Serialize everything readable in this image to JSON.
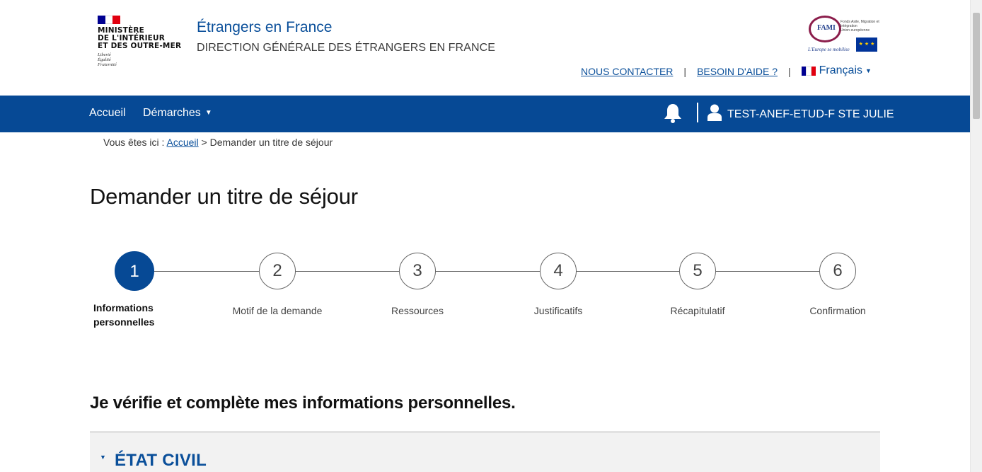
{
  "header": {
    "ministry_lines": [
      "MINISTÈRE",
      "DE L'INTÉRIEUR",
      "ET DES OUTRE-MER"
    ],
    "motto_lines": [
      "Liberté",
      "Égalité",
      "Fraternité"
    ],
    "site_title": "Étrangers en France",
    "site_subtitle": "DIRECTION GÉNÉRALE DES ÉTRANGERS EN FRANCE",
    "fami_text": "FAMI",
    "fami_small": "Fonds Asile, Migration et Intégration",
    "fami_union": "Union européenne",
    "fami_slogan": "L'Europe se mobilise",
    "links": {
      "contact": "NOUS CONTACTER",
      "help": "BESOIN D'AIDE ?",
      "separator": "|",
      "language": "Français"
    }
  },
  "nav": {
    "home": "Accueil",
    "procedures": "Démarches",
    "user_name": "TEST-ANEF-ETUD-F STE JULIE"
  },
  "breadcrumb": {
    "prefix": "Vous êtes ici :",
    "home": "Accueil",
    "current": "> Demander un titre de séjour"
  },
  "page_title": "Demander un titre de séjour",
  "stepper": {
    "steps": [
      {
        "number": "1",
        "label": "Informations personnelles",
        "active": true
      },
      {
        "number": "2",
        "label": "Motif de la demande"
      },
      {
        "number": "3",
        "label": "Ressources"
      },
      {
        "number": "4",
        "label": "Justificatifs"
      },
      {
        "number": "5",
        "label": "Récapitulatif"
      },
      {
        "number": "6",
        "label": "Confirmation"
      }
    ]
  },
  "section_intro": "Je vérifie et complète mes informations personnelles.",
  "accordion": {
    "title": "ÉTAT CIVIL"
  },
  "colors": {
    "primary": "#064995",
    "link": "#0a4f9a",
    "flag_blue": "#000091",
    "flag_red": "#e1000f"
  },
  "icons": {
    "bell": "bell-icon",
    "user": "user-icon",
    "caret": "caret-down-icon"
  }
}
